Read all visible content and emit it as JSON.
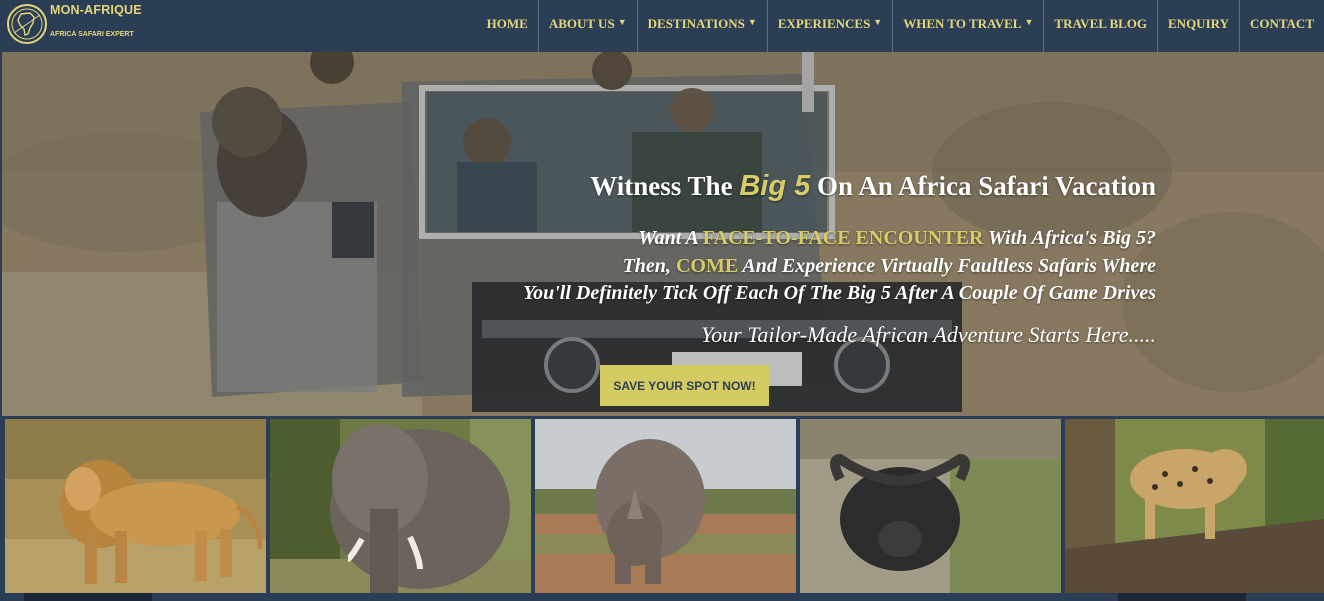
{
  "brand": {
    "name": "MON-AFRIQUE",
    "tagline": "AFRICA SAFARI EXPERT"
  },
  "nav": [
    {
      "label": "HOME",
      "dropdown": false
    },
    {
      "label": "ABOUT US",
      "dropdown": true
    },
    {
      "label": "DESTINATIONS",
      "dropdown": true
    },
    {
      "label": "EXPERIENCES",
      "dropdown": true
    },
    {
      "label": "WHEN TO TRAVEL",
      "dropdown": true
    },
    {
      "label": "TRAVEL BLOG",
      "dropdown": false
    },
    {
      "label": "ENQUIRY",
      "dropdown": false
    },
    {
      "label": "CONTACT",
      "dropdown": false
    }
  ],
  "hero": {
    "title_pre": "Witness The ",
    "title_accent": "Big 5",
    "title_post": " On An Africa Safari Vacation",
    "line1_pre": "Want A ",
    "line1_hl": "FACE-TO-FACE ENCOUNTER",
    "line1_post": " With Africa's Big 5?",
    "line2_pre": "Then, ",
    "line2_hl": "COME",
    "line2_post": " And Experience Virtually Faultless Safaris Where",
    "line3": "You'll Definitely Tick Off Each Of The Big 5 After A Couple Of Game Drives",
    "tagline": "Your Tailor-Made African Adventure Starts Here.....",
    "cta": "SAVE YOUR SPOT NOW!"
  },
  "colors": {
    "header_bg": "#2c3e55",
    "accent": "#d4cc62",
    "nav_text": "#e3d779"
  }
}
